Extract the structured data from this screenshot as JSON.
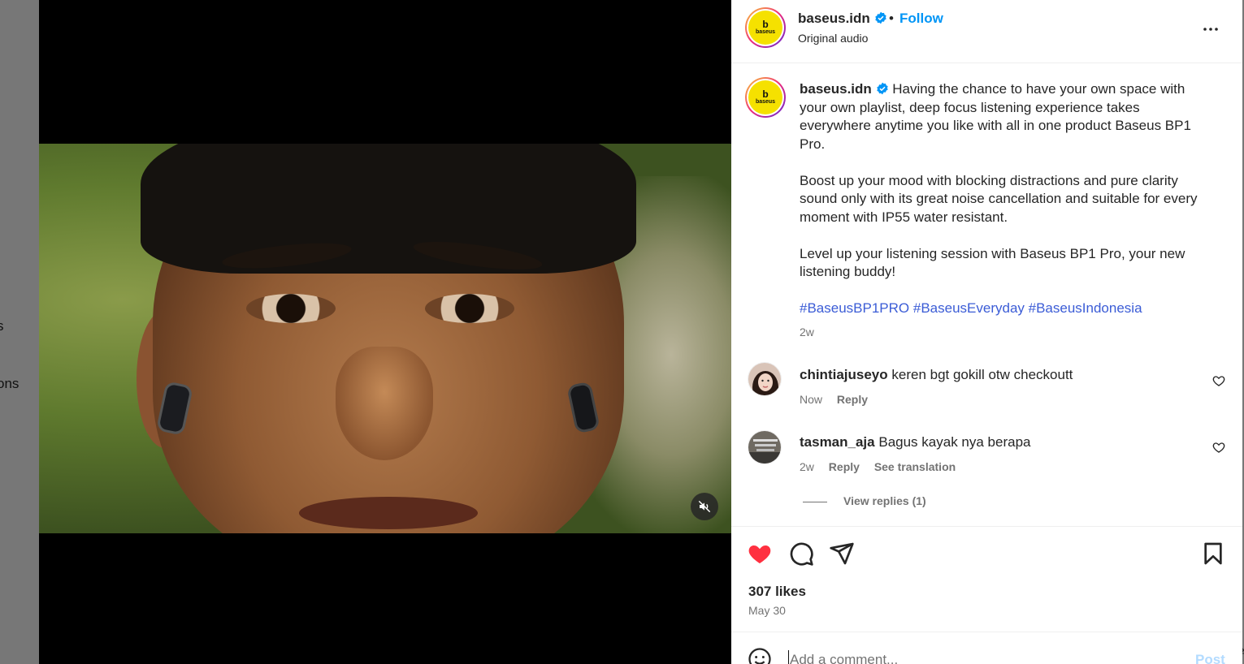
{
  "background": {
    "left_fragments": [
      "s",
      "ons"
    ],
    "right_fragment": "⇄"
  },
  "post": {
    "author": "baseus.idn",
    "avatar_text": "b",
    "avatar_sub": "baseus",
    "separator": "•",
    "follow_label": "Follow",
    "audio": "Original audio",
    "more_icon": "more-horizontal-icon",
    "caption_paragraphs": [
      "Having the chance to have your own space with your own playlist, deep focus listening experience takes everywhere anytime you like with all in one product Baseus BP1 Pro.",
      "Boost up your mood with blocking distractions and pure clarity sound only with its great noise cancellation and suitable for every moment with IP55 water resistant.",
      "Level up your listening session with Baseus BP1 Pro, your new listening buddy!"
    ],
    "hashtags": [
      "#BaseusBP1PRO",
      "#BaseusEveryday",
      "#BaseusIndonesia"
    ],
    "caption_time": "2w"
  },
  "comments": [
    {
      "user": "chintiajuseyo",
      "text": "keren bgt gokill otw checkoutt",
      "time": "Now",
      "reply_label": "Reply"
    },
    {
      "user": "tasman_aja",
      "text": "Bagus kayak nya berapa",
      "time": "2w",
      "reply_label": "Reply",
      "translate_label": "See translation"
    }
  ],
  "view_replies_label": "View replies (1)",
  "stats": {
    "likes": "307 likes",
    "date": "May 30"
  },
  "composer": {
    "placeholder": "Add a comment...",
    "post_label": "Post"
  },
  "colors": {
    "accent": "#0095f6",
    "like": "#ff3040",
    "hashtag": "#3b5cd6",
    "post_disabled": "#b3dbff"
  }
}
